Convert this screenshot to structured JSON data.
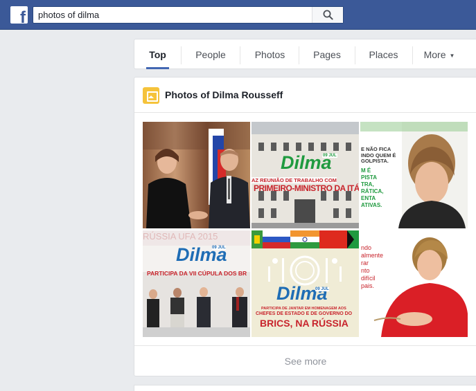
{
  "header": {
    "logo": "f",
    "search_value": "photos of dilma",
    "search_icon": "search-icon"
  },
  "tabs": [
    {
      "label": "Top",
      "active": true
    },
    {
      "label": "People",
      "active": false
    },
    {
      "label": "Photos",
      "active": false
    },
    {
      "label": "Pages",
      "active": false
    },
    {
      "label": "Places",
      "active": false
    },
    {
      "label": "More",
      "active": false
    }
  ],
  "photos_section": {
    "icon": "photos-icon",
    "title": "Photos of Dilma Rousseff",
    "see_more": "See more",
    "photos": [
      {
        "overlay": []
      },
      {
        "overlay": [
          "09 JUL",
          "Dilma",
          "AZ REUNIÃO DE TRABALHO COM",
          "PRIMEIRO-MINISTRO DA ITÁLIA"
        ]
      },
      {
        "overlay": [
          "E NÃO FICA",
          "INDO QUEM É",
          "GOLPISTA.",
          "M É",
          "PISTA",
          "TRA,",
          "RÁTICA,",
          "ENTA",
          "ATIVAS."
        ]
      },
      {
        "overlay": [
          "RÚSSIA UFA 2015",
          "09 JUL",
          "Dilma",
          "PARTICIPA DA VII CÚPULA DOS BR"
        ]
      },
      {
        "overlay": [
          "09 JUL",
          "Dilma",
          "PARTICIPA DE JANTAR EM HOMENAGEM AOS",
          "CHEFES DE ESTADO E DE GOVERNO DO",
          "BRICS, NA RÚSSIA"
        ]
      },
      {
        "overlay": [
          "ndo",
          "almente",
          "rar",
          "nto",
          "difícil",
          "pais."
        ]
      }
    ]
  },
  "colors": {
    "topbar": "#3b5998",
    "accent": "#4267b2",
    "dilma_green": "#1f9a3f",
    "dilma_blue": "#1f6db5",
    "photos_icon": "#f5c33b"
  }
}
